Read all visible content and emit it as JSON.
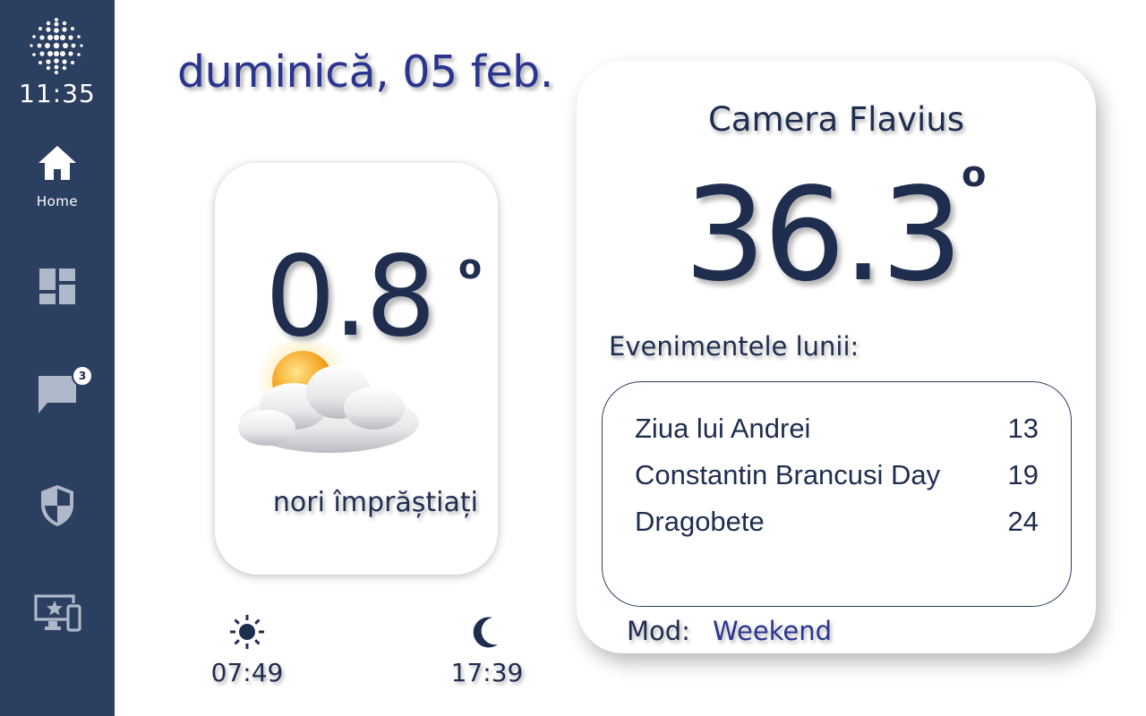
{
  "sidebar": {
    "logo_icon": "dotted-sphere-logo-icon",
    "clock": "11:35",
    "items": [
      {
        "icon": "home-icon",
        "label": "Home",
        "active": true
      },
      {
        "icon": "dashboard-icon"
      },
      {
        "icon": "chat-icon",
        "badge": "3"
      },
      {
        "icon": "shield-icon"
      },
      {
        "icon": "devices-icon"
      }
    ]
  },
  "header": {
    "date": "duminică, 05 feb."
  },
  "weather": {
    "temperature": "0.8",
    "degree_symbol": "o",
    "icon": "sun-behind-cloud-icon",
    "condition": "nori împrăștiați",
    "sunrise": "07:49",
    "sunset": "17:39"
  },
  "room": {
    "name": "Camera Flavius",
    "temperature": "36.3",
    "degree_symbol": "o",
    "events_title": "Evenimentele lunii:",
    "events": [
      {
        "name": "Ziua lui Andrei",
        "day": "13"
      },
      {
        "name": "Constantin Brancusi Day",
        "day": "19"
      },
      {
        "name": "Dragobete",
        "day": "24"
      }
    ],
    "mode_label": "Mod:",
    "mode_value": "Weekend"
  },
  "colors": {
    "sidebar_bg": "#2b3f60",
    "text_dark": "#1f2d4f",
    "accent": "#2a3590"
  }
}
